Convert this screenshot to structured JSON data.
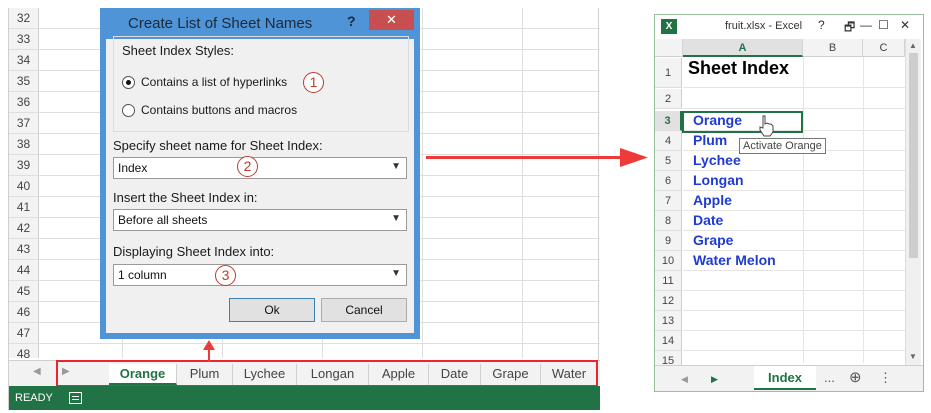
{
  "left_excel": {
    "row_numbers": [
      "32",
      "33",
      "34",
      "35",
      "36",
      "37",
      "38",
      "39",
      "40",
      "41",
      "42",
      "43",
      "44",
      "45",
      "46",
      "47",
      "48"
    ],
    "sheet_tabs": [
      "Orange",
      "Plum",
      "Lychee",
      "Longan",
      "Apple",
      "Date",
      "Grape",
      "Water"
    ],
    "active_tab": "Orange",
    "status": "READY"
  },
  "dialog": {
    "title": "Create List of Sheet Names",
    "help_label": "?",
    "close_label": "✕",
    "styles_group_label": "Sheet Index Styles:",
    "option_hyperlinks": "Contains a list of hyperlinks",
    "option_buttons": "Contains buttons and macros",
    "sheet_name_label": "Specify sheet name for Sheet Index:",
    "sheet_name_value": "Index",
    "insert_label": "Insert the Sheet Index in:",
    "insert_value": "Before all sheets",
    "display_label": "Displaying Sheet Index into:",
    "display_value": "1 column",
    "ok_label": "Ok",
    "cancel_label": "Cancel",
    "badges": [
      "1",
      "2",
      "3"
    ]
  },
  "right_excel": {
    "logo": "X",
    "window_title": "fruit.xlsx - Excel",
    "help_btn": "?",
    "restore_btn": "🗗",
    "minimize_btn": "—",
    "maximize_btn": "☐",
    "close_btn": "✕",
    "columns": [
      "A",
      "B",
      "C"
    ],
    "rows": [
      {
        "num": "1",
        "text": ""
      },
      {
        "num": "2",
        "text": ""
      },
      {
        "num": "3",
        "text": "Orange"
      },
      {
        "num": "4",
        "text": "Plum"
      },
      {
        "num": "5",
        "text": "Lychee"
      },
      {
        "num": "6",
        "text": "Longan"
      },
      {
        "num": "7",
        "text": "Apple"
      },
      {
        "num": "8",
        "text": "Date"
      },
      {
        "num": "9",
        "text": "Grape"
      },
      {
        "num": "10",
        "text": "Water Melon"
      },
      {
        "num": "11",
        "text": ""
      },
      {
        "num": "12",
        "text": ""
      },
      {
        "num": "13",
        "text": ""
      },
      {
        "num": "14",
        "text": ""
      },
      {
        "num": "15",
        "text": ""
      }
    ],
    "header_cell": "Sheet Index",
    "tooltip": "Activate Orange",
    "sheet_tab": "Index",
    "more_tabs": "...",
    "add_sheet": "⊕",
    "options": "⋮"
  },
  "colors": {
    "excel_green": "#217346",
    "dialog_blue": "#4f94d6",
    "arrow_red": "#ef3a3a",
    "hyperlink_blue": "#1f3bd2"
  }
}
